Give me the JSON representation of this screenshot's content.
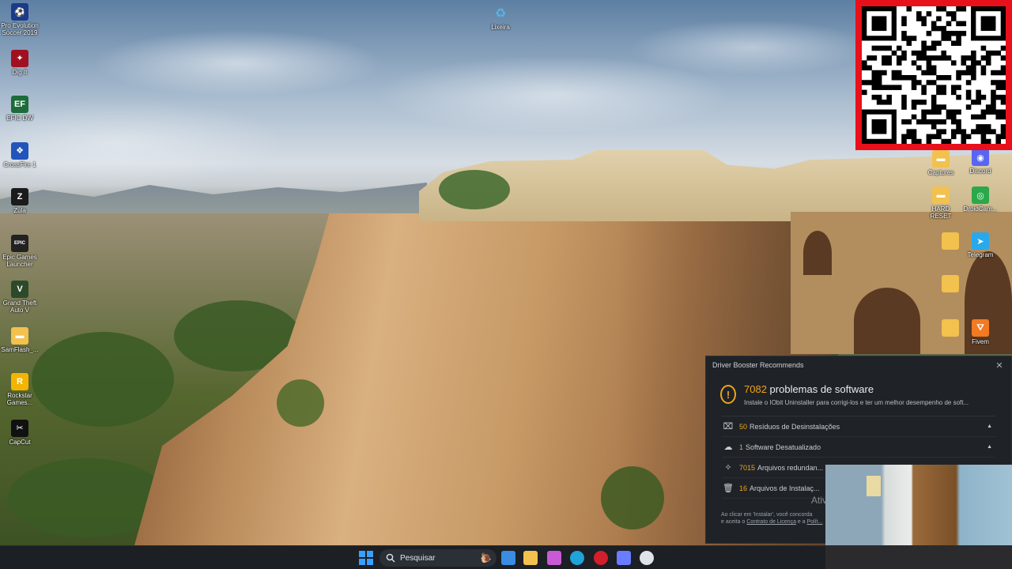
{
  "desktop": {
    "left_icons": [
      {
        "label": "Pro Evolution Soccer 2019",
        "glyph": "⚽",
        "color": "#1a3a8a"
      },
      {
        "label": "Dig It",
        "glyph": "✦",
        "color": "#a01020"
      },
      {
        "label": "EFIC DW",
        "glyph": "EF",
        "color": "#1d6b3a"
      },
      {
        "label": "CrossFire 1",
        "glyph": "❖",
        "color": "#2255bb"
      },
      {
        "label": "Zula",
        "glyph": "Z",
        "color": "#1b1b1b"
      },
      {
        "label": "Epic Games Launcher",
        "glyph": "EPIC",
        "color": "#222"
      },
      {
        "label": "Grand Theft Auto V",
        "glyph": "V",
        "color": "#2c4a2a"
      },
      {
        "label": "SamFlash_...",
        "glyph": "▬",
        "color": "#f2c14e"
      },
      {
        "label": "Rockstar Games...",
        "glyph": "R",
        "color": "#f4b400"
      },
      {
        "label": "CapCut",
        "glyph": "✂",
        "color": "#111"
      }
    ],
    "top_icon": {
      "label": "Lixeira",
      "glyph": "♻",
      "color": "#5ab4e6"
    },
    "right_icons": [
      {
        "label": "Captures",
        "glyph": "▬",
        "color": "#f2c14e"
      },
      {
        "label": "Discord",
        "glyph": "◉",
        "color": "#5865f2"
      },
      {
        "label": "HARD RESET",
        "glyph": "▬",
        "color": "#f2c14e"
      },
      {
        "label": "DroidCam...",
        "glyph": "◎",
        "color": "#2aa84a"
      },
      {
        "label": "Telegram",
        "glyph": "➤",
        "color": "#29a9eb"
      },
      {
        "label": "Fivem",
        "glyph": "⛛",
        "color": "#f27a21"
      }
    ]
  },
  "driver_booster": {
    "window_title": "Driver Booster Recommends",
    "close_glyph": "✕",
    "count": "7082",
    "headline": "problemas de software",
    "subtext": "Instale o IObit Uninstaller para corrigi-los e ter um melhor desempenho de soft...",
    "rows": [
      {
        "icon": "⌧",
        "count": "50",
        "label": "Resíduos de Desinstalações",
        "caret": "▲"
      },
      {
        "icon": "☁",
        "count": "1",
        "label": "Software Desatualizado",
        "caret": "▲"
      },
      {
        "icon": "✧",
        "count": "7015",
        "label": "Arquivos redundan...",
        "caret": ""
      },
      {
        "icon": "🗑",
        "count": "16",
        "label": "Arquivos de Instalaç...",
        "caret": ""
      }
    ],
    "watermark": "Ativ",
    "legal_line1": "Ao clicar em 'Instalar', você concorda",
    "legal_line2_prefix": "e aceita o ",
    "legal_link1": "Contrato de Licença",
    "legal_mid": " e a ",
    "legal_link2": "Polít..."
  },
  "taskbar": {
    "search_placeholder": "Pesquisar",
    "apps": [
      {
        "name": "store",
        "color": "#3a8de0"
      },
      {
        "name": "explorer",
        "color": "#f2c14e"
      },
      {
        "name": "copilot",
        "color": "#c85ad6"
      },
      {
        "name": "edge",
        "color": "#1fa3d8"
      },
      {
        "name": "recorder",
        "color": "#d21f2b"
      },
      {
        "name": "vpn",
        "color": "#6a7cff"
      },
      {
        "name": "steam-like",
        "color": "#dfe3e7"
      }
    ]
  },
  "colors": {
    "accent_orange": "#f0a11b",
    "panel_bg": "#1f2328",
    "qr_border": "#e8101a"
  }
}
